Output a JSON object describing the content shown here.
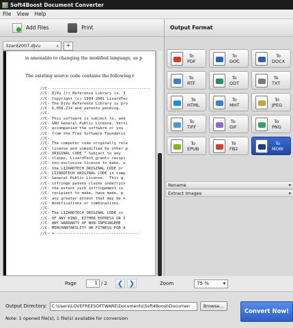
{
  "window": {
    "title": "Soft4Boost Document Converter"
  },
  "menu": [
    "File",
    "View",
    "Help"
  ],
  "toolbar": {
    "add_files": "Add Files",
    "print": "Print"
  },
  "tab": {
    "name": "lizard2007.djvu",
    "close": "x",
    "new": "+"
  },
  "document": {
    "lines": [
      "is amenable to changing the modified language, as p",
      "The existing source code contains the following r"
    ],
    "code": [
      "//C- -------------------------------------------",
      "//C- DjVu (r) Reference Library (v. 3",
      "//C- Copyright (c) 1999-2001 LizardTec",
      "//C- The DjVu Reference Library is pro",
      "//C- 6,058,214 and patents pending.",
      "//C-",
      "//C- This software is subject to, and",
      "//C- GNU General Public License, Versi",
      "//C- accompanied the software or you ",
      "//C- from the Free Software Foundatio",
      "//C-",
      "//C- The computer code originally rele",
      "//C- license and unmodified by other p",
      "//C- ORIGINAL CODE.\" Subject to any",
      "//C- claims, LizardTech grants recipi",
      "//C- non-exclusive license to make, u",
      "//C- the LIZARDTECH ORIGINAL CODE or ",
      "//C- LIZARDTECH ORIGINAL CODE in comp",
      "//C- General Public License.  This g",
      "//C- infringe patent claims underlyin",
      "//C- the extent such infringement is",
      "//C- recipient to make, have made, p",
      "//C- any greater extent that may be n",
      "//C- modifications or combinations.",
      "//C-",
      "//C- The LIZARDTECH ORIGINAL CODE is ",
      "//C- OF ANY KIND, EITHER EXPRESS OR I",
      "//C- ANY WARRANTY OF NON-INFRINGEME",
      "//C- MERCHANTABILITY OR FITNESS FOR A",
      "//C- +-------------------------------------"
    ]
  },
  "pager": {
    "label": "Page",
    "current": "1",
    "total": "/ 2",
    "zoom_label": "Zoom",
    "zoom": "75 %"
  },
  "output_format": {
    "title": "Output Format",
    "buttons": [
      {
        "line1": "To",
        "line2": "PDF",
        "color": "#d23a2a"
      },
      {
        "line1": "To",
        "line2": "DOC",
        "color": "#2c5fb8"
      },
      {
        "line1": "To",
        "line2": "DOCX",
        "color": "#2c5fb8"
      },
      {
        "line1": "To",
        "line2": "RTF",
        "color": "#3f7fd0"
      },
      {
        "line1": "To",
        "line2": "ODT",
        "color": "#2b8b6a"
      },
      {
        "line1": "To",
        "line2": "TXT",
        "color": "#7a7a7a"
      },
      {
        "line1": "To",
        "line2": "HTML",
        "color": "#1f8fd8"
      },
      {
        "line1": "To",
        "line2": "MHT",
        "color": "#3a7fd0"
      },
      {
        "line1": "To",
        "line2": "JPEG",
        "color": "#c7a33a"
      },
      {
        "line1": "To",
        "line2": "TIFF",
        "color": "#4a9ad8"
      },
      {
        "line1": "To",
        "line2": "GIF",
        "color": "#8a6ad0"
      },
      {
        "line1": "To",
        "line2": "PNG",
        "color": "#3a9a6a"
      },
      {
        "line1": "To",
        "line2": "EPUB",
        "color": "#8ab02a"
      },
      {
        "line1": "To",
        "line2": "FB2",
        "color": "#c8432a"
      },
      {
        "line1": "To",
        "line2": "MOBI",
        "color": "#1c3b8a"
      }
    ],
    "rename": "Rename",
    "extract": "Extract Images"
  },
  "bottom": {
    "outdir_label": "Output Directory:",
    "outdir_value": "C:\\Users\\LOVEFREESOFTWARE\\Documents\\Soft4Boost\\Documen",
    "browse": "Browse...",
    "convert": "Convert Now!",
    "note": "Note: 1 opened file(s), 1 file(s) available for conversion"
  }
}
